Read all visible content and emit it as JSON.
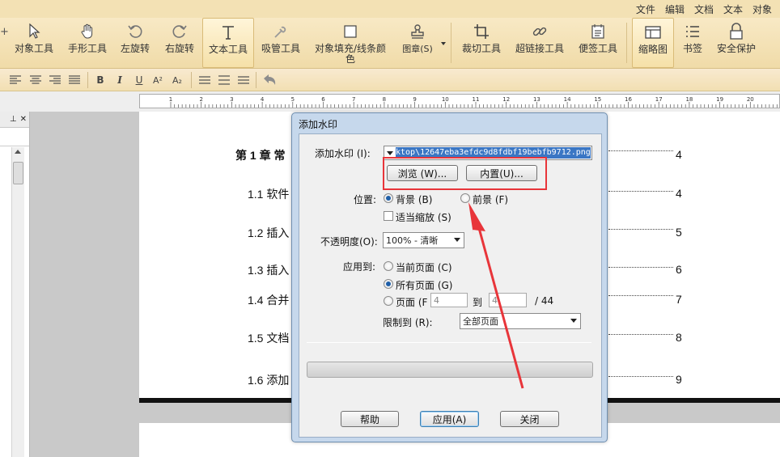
{
  "menubar": {
    "items": [
      "文件",
      "编辑",
      "文档",
      "文本",
      "对象"
    ]
  },
  "toolbar": {
    "object_tool": "对象工具",
    "hand_tool": "手形工具",
    "rotate_left": "左旋转",
    "rotate_right": "右旋转",
    "text_tool": "文本工具",
    "eyedropper_tool": "吸管工具",
    "fill_line_color": "对象填充/线条颜色",
    "stamp": "图章(S)",
    "crop_tool": "裁切工具",
    "hyperlink_tool": "超链接工具",
    "note_tool": "便签工具",
    "thumbnail": "缩略图",
    "bookmark": "书签",
    "security": "安全保护"
  },
  "formatbar": {
    "bold": "B",
    "italic": "I",
    "underline": "U",
    "superscript": "A²",
    "subscript": "A₂"
  },
  "ruler": {
    "labels": [
      "1",
      "2",
      "3",
      "4",
      "5",
      "6",
      "7",
      "8",
      "9",
      "10",
      "11",
      "12",
      "13",
      "14",
      "15",
      "16",
      "17",
      "18",
      "19",
      "20"
    ]
  },
  "document": {
    "toc": [
      {
        "title": "第 1 章  常",
        "page": "4"
      },
      {
        "title": "1.1 软件",
        "page": "4"
      },
      {
        "title": "1.2 插入",
        "page": "5"
      },
      {
        "title": "1.3 插入",
        "page": "6"
      },
      {
        "title": "1.4 合并",
        "page": "7"
      },
      {
        "title": "1.5 文档",
        "page": "8"
      },
      {
        "title": "1.6 添加",
        "page": "9"
      }
    ]
  },
  "dialog": {
    "title": "添加水印",
    "watermark_label": "添加水印 (I):",
    "watermark_path": "ktop\\12647eba3efdc9d8fdbf19bebfb9712.png",
    "browse_button": "浏览 (W)...",
    "builtin_button": "内置(U)...",
    "position_label": "位置:",
    "background_option": "背景 (B)",
    "foreground_option": "前景 (F)",
    "fit_scale_option": "适当缩放 (S)",
    "opacity_label": "不透明度(O):",
    "opacity_value": "100% - 清晰",
    "apply_to_label": "应用到:",
    "current_page_option": "当前页面 (C)",
    "all_pages_option": "所有页面 (G)",
    "pages_option": "页面 (F",
    "page_from": "4",
    "to_label": "到",
    "page_to": "4",
    "page_total": "/  44",
    "limit_label": "限制到 (R):",
    "limit_value": "全部页面",
    "help_button": "帮助",
    "apply_button": "应用(A)",
    "close_button": "关闭"
  },
  "colors": {
    "annotation": "#e8353a",
    "toolbar_bg": "#f3e1b4"
  }
}
